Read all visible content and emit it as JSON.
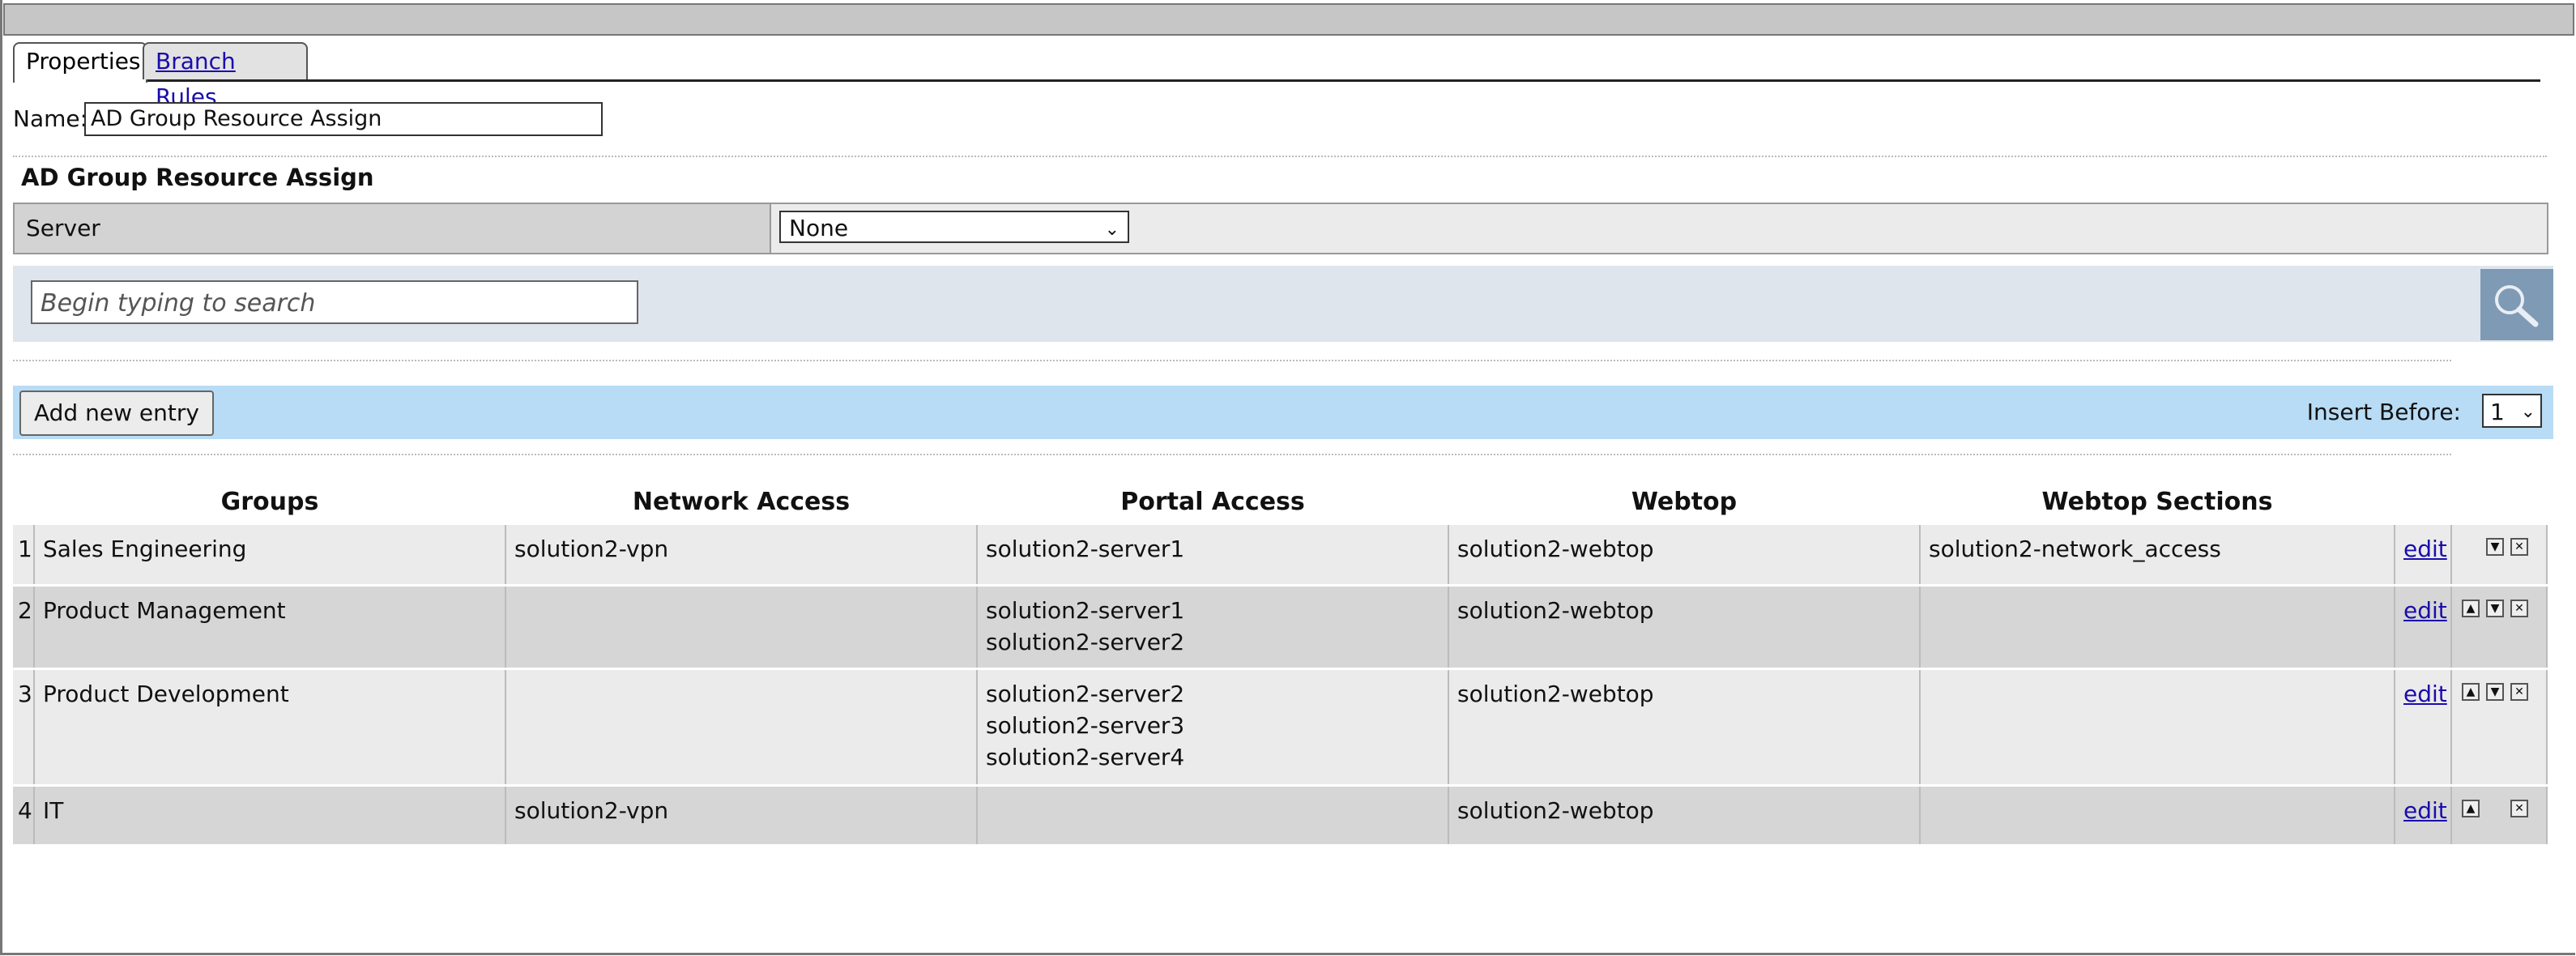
{
  "tabs": [
    {
      "label": "Properties"
    },
    {
      "label": "Branch Rules"
    }
  ],
  "name": {
    "label": "Name:",
    "value": "AD Group Resource Assign"
  },
  "section_title": "AD Group Resource Assign",
  "server": {
    "label": "Server",
    "selected": "None"
  },
  "search": {
    "placeholder": "Begin typing to search"
  },
  "actions": {
    "add_label": "Add new entry",
    "insert_before_label": "Insert Before:",
    "insert_before_value": "1"
  },
  "table": {
    "headers": [
      "Groups",
      "Network Access",
      "Portal Access",
      "Webtop",
      "Webtop Sections"
    ],
    "edit_label": "edit",
    "rows": [
      {
        "num": "1",
        "group": "Sales Engineering",
        "network": "solution2-vpn",
        "portal": [
          "solution2-server1"
        ],
        "webtop": "solution2-webtop",
        "sections": "solution2-network_access"
      },
      {
        "num": "2",
        "group": "Product Management",
        "network": "",
        "portal": [
          "solution2-server1",
          "solution2-server2"
        ],
        "webtop": "solution2-webtop",
        "sections": ""
      },
      {
        "num": "3",
        "group": "Product Development",
        "network": "",
        "portal": [
          "solution2-server2",
          "solution2-server3",
          "solution2-server4"
        ],
        "webtop": "solution2-webtop",
        "sections": ""
      },
      {
        "num": "4",
        "group": "IT",
        "network": "solution2-vpn",
        "portal": [],
        "webtop": "solution2-webtop",
        "sections": ""
      }
    ]
  }
}
